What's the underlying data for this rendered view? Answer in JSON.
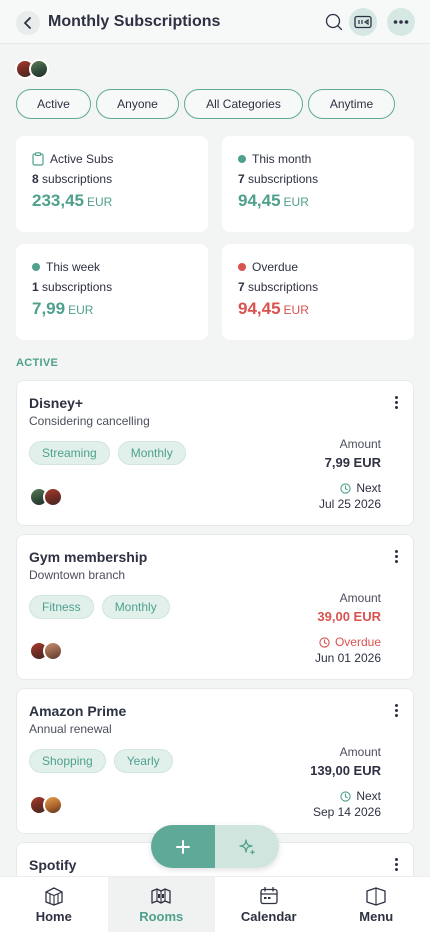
{
  "header": {
    "title": "Monthly Subscriptions",
    "back_icon": "chevron-left-icon",
    "search_icon": "search-icon",
    "view_icon": "view-toggle-icon",
    "more_icon": "more-horizontal-icon"
  },
  "filters": [
    "Active",
    "Anyone",
    "All Categories",
    "Anytime"
  ],
  "stats": {
    "active": {
      "label": "Active Subs",
      "count_num": "8",
      "count_word": "subscriptions",
      "amount": "233,45",
      "currency": "EUR",
      "icon": "clipboard-icon"
    },
    "month": {
      "label": "This month",
      "count_num": "7",
      "count_word": "subscriptions",
      "amount": "94,45",
      "currency": "EUR",
      "dot_color": "#4fa08d"
    },
    "week": {
      "label": "This week",
      "count_num": "1",
      "count_word": "subscriptions",
      "amount": "7,99",
      "currency": "EUR",
      "dot_color": "#4fa08d"
    },
    "overdue": {
      "label": "Overdue",
      "count_num": "7",
      "count_word": "subscriptions",
      "amount": "94,45",
      "currency": "EUR",
      "dot_color": "#d9534f"
    }
  },
  "section_label": "ACTIVE",
  "subscriptions": [
    {
      "name": "Disney+",
      "note": "Considering cancelling",
      "tags": [
        "Streaming",
        "Monthly"
      ],
      "amount_label": "Amount",
      "amount": "7,99 EUR",
      "status": "Next",
      "date": "Jul 25 2026",
      "overdue": false
    },
    {
      "name": "Gym membership",
      "note": "Downtown branch",
      "tags": [
        "Fitness",
        "Monthly"
      ],
      "amount_label": "Amount",
      "amount": "39,00 EUR",
      "status": "Overdue",
      "date": "Jun 01 2026",
      "overdue": true
    },
    {
      "name": "Amazon Prime",
      "note": "Annual renewal",
      "tags": [
        "Shopping",
        "Yearly"
      ],
      "amount_label": "Amount",
      "amount": "139,00 EUR",
      "status": "Next",
      "date": "Sep 14 2026",
      "overdue": false
    },
    {
      "name": "Spotify"
    }
  ],
  "fab": {
    "add_icon": "plus-icon",
    "ai_icon": "sparkle-icon"
  },
  "nav": [
    {
      "label": "Home",
      "icon": "home-box-icon"
    },
    {
      "label": "Rooms",
      "icon": "rooms-icon",
      "active": true
    },
    {
      "label": "Calendar",
      "icon": "calendar-icon"
    },
    {
      "label": "Menu",
      "icon": "map-menu-icon"
    }
  ],
  "colors": {
    "accent": "#4fa08d",
    "danger": "#d9534f",
    "text": "#2d3142"
  }
}
